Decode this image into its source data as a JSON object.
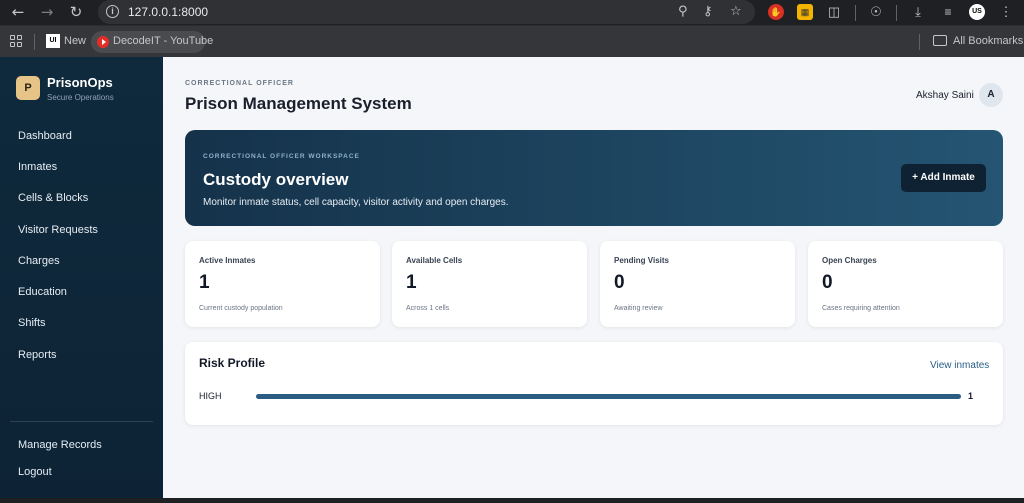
{
  "browser": {
    "url": "127.0.0.1:8000",
    "bookmarks": {
      "new_label": "New",
      "youtube_label": "DecodeIT - YouTube",
      "all_bookmarks": "All Bookmarks"
    }
  },
  "sidebar": {
    "brand_initial": "P",
    "brand_name": "PrisonOps",
    "brand_subtitle": "Secure Operations",
    "nav": [
      {
        "label": "Dashboard"
      },
      {
        "label": "Inmates"
      },
      {
        "label": "Cells & Blocks"
      },
      {
        "label": "Visitor Requests"
      },
      {
        "label": "Charges"
      },
      {
        "label": "Education"
      },
      {
        "label": "Shifts"
      },
      {
        "label": "Reports"
      }
    ],
    "footer": [
      {
        "label": "Manage Records"
      },
      {
        "label": "Logout"
      }
    ]
  },
  "header": {
    "role": "CORRECTIONAL OFFICER",
    "title": "Prison Management System",
    "user_name": "Akshay Saini",
    "avatar_initial": "A"
  },
  "hero": {
    "caption": "CORRECTIONAL OFFICER WORKSPACE",
    "title": "Custody overview",
    "description": "Monitor inmate status, cell capacity, visitor activity and open charges.",
    "button_label": "+ Add Inmate"
  },
  "stats": [
    {
      "label": "Active Inmates",
      "value": "1",
      "sub": "Current custody population"
    },
    {
      "label": "Available Cells",
      "value": "1",
      "sub": "Across 1 cells"
    },
    {
      "label": "Pending Visits",
      "value": "0",
      "sub": "Awaiting review"
    },
    {
      "label": "Open Charges",
      "value": "0",
      "sub": "Cases requiring attention"
    }
  ],
  "risk": {
    "title": "Risk Profile",
    "link": "View inmates",
    "rows": [
      {
        "level": "HIGH",
        "count": "1",
        "fraction": 1.0
      }
    ]
  },
  "colors": {
    "sidebar": "#0f2a3d",
    "accent": "#2b5d82",
    "brand": "#e6c487"
  }
}
